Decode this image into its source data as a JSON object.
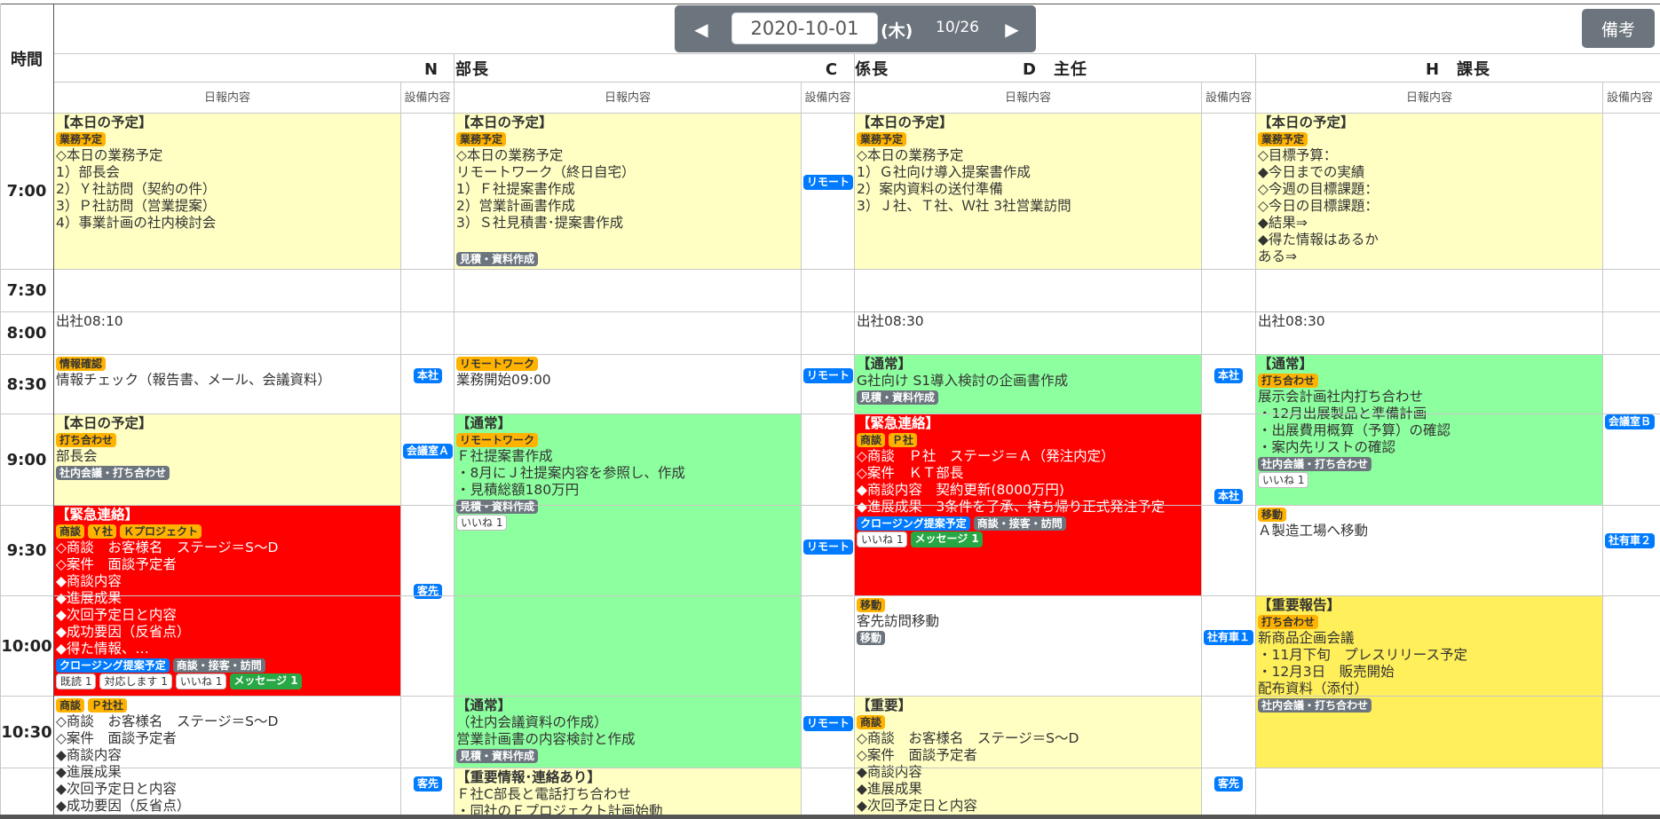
{
  "nav": {
    "prev_icon": "◀",
    "date_value": "2020-10-01",
    "weekday": "(木)",
    "counter": "10/26",
    "next_icon": "▶",
    "notes_button": "備考"
  },
  "table": {
    "time_header": "時間",
    "sub_report": "日報内容",
    "sub_equip_line1": "設備",
    "sub_equip_line2": "内容",
    "people": [
      "N　部長",
      "C　係長",
      "D　主任",
      "H　課長"
    ],
    "time_slots": [
      "7:00",
      "7:30",
      "8:00",
      "8:30",
      "9:00",
      "9:30",
      "10:00",
      "10:30"
    ]
  },
  "entries": [
    {
      "id": "n-700",
      "col": 0,
      "color": "yellow",
      "title": "【本日の予定】",
      "tags_before": [
        {
          "text": "業務予定",
          "style": "orange"
        }
      ],
      "lines": [
        "◇本日の業務予定",
        "1）部長会",
        "2）Ｙ社訪問（契約の件）",
        "3）Ｐ社訪問（営業提案）",
        "4）事業計画の社内検討会"
      ],
      "tags_after": []
    },
    {
      "id": "n-800",
      "col": 0,
      "color": "white",
      "title": "",
      "tags_before": [],
      "lines": [
        "出社08:10"
      ],
      "tags_after": []
    },
    {
      "id": "n-830",
      "col": 0,
      "color": "white",
      "title": "",
      "tags_before": [
        {
          "text": "情報確認",
          "style": "orange"
        }
      ],
      "lines": [
        "情報チェック（報告書、メール、会議資料）"
      ],
      "tags_after": []
    },
    {
      "id": "n-900",
      "col": 0,
      "color": "yellow",
      "title": "【本日の予定】",
      "tags_before": [
        {
          "text": "打ち合わせ",
          "style": "orange"
        }
      ],
      "lines": [
        "部長会"
      ],
      "tags_after": [
        {
          "text": "社内会議・打ち合わせ",
          "style": "gray"
        }
      ]
    },
    {
      "id": "n-930",
      "col": 0,
      "color": "red",
      "title": "【緊急連絡】",
      "tags_before": [
        {
          "text": "商談",
          "style": "orange"
        },
        {
          "text": "Ｙ社",
          "style": "orange"
        },
        {
          "text": "Ｋプロジェクト",
          "style": "orange"
        }
      ],
      "lines": [
        "◇商談　お客様名　ステージ＝S～D",
        "◇案件　面談予定者",
        "◆商談内容",
        "◆進展成果",
        "◆次回予定日と内容",
        "◆成功要因（反省点）",
        "◆得た情報、…"
      ],
      "tags_after": [
        {
          "text": "クロージング提案予定",
          "style": "blue"
        },
        {
          "text": "商談・接客・訪問",
          "style": "gray"
        }
      ],
      "tags_after2": [
        {
          "text": "既読 1",
          "style": "white"
        },
        {
          "text": "対応します 1",
          "style": "white"
        },
        {
          "text": "いいね 1",
          "style": "white"
        },
        {
          "text": "メッセージ 1",
          "style": "green"
        }
      ]
    },
    {
      "id": "n-1030",
      "col": 0,
      "color": "white",
      "title": "",
      "tags_before": [
        {
          "text": "商談",
          "style": "orange"
        },
        {
          "text": "Ｐ社社",
          "style": "orange"
        }
      ],
      "lines": [
        "◇商談　お客様名　ステージ＝S～D",
        "◇案件　面談予定者",
        "◆商談内容",
        "◆進展成果",
        "◆次回予定日と内容",
        "◆成功要因（反省点）"
      ],
      "tags_after": []
    },
    {
      "id": "c-700",
      "col": 1,
      "color": "yellow",
      "title": "【本日の予定】",
      "tags_before": [
        {
          "text": "業務予定",
          "style": "orange"
        }
      ],
      "lines": [
        "◇本日の業務予定",
        "リモートワーク（終日自宅）",
        "1）Ｆ社提案書作成",
        "2）営業計画書作成",
        "3）Ｓ社見積書･提案書作成"
      ],
      "tags_after": [
        {
          "text": "見積・資料作成",
          "style": "gray"
        }
      ]
    },
    {
      "id": "c-830",
      "col": 1,
      "color": "white",
      "title": "",
      "tags_before": [
        {
          "text": "リモートワーク",
          "style": "orange"
        }
      ],
      "lines": [
        "業務開始09:00"
      ],
      "tags_after": []
    },
    {
      "id": "c-900",
      "col": 1,
      "color": "green",
      "title": "【通常】",
      "tags_before": [
        {
          "text": "リモートワーク",
          "style": "orange"
        }
      ],
      "lines": [
        "Ｆ社提案書作成",
        "・8月にＪ社提案内容を参照し、作成",
        "・見積総額180万円"
      ],
      "tags_after": [
        {
          "text": "見積・資料作成",
          "style": "gray"
        }
      ],
      "tags_after2": [
        {
          "text": "いいね 1",
          "style": "white"
        }
      ]
    },
    {
      "id": "c-1030",
      "col": 1,
      "color": "green",
      "title": "【通常】",
      "tags_before": [],
      "lines": [
        "（社内会議資料の作成）",
        "営業計画書の内容検討と作成"
      ],
      "tags_after": [
        {
          "text": "見積・資料作成",
          "style": "gray"
        }
      ]
    },
    {
      "id": "c-1100",
      "col": 1,
      "color": "yellow",
      "title": "【重要情報･連絡あり】",
      "tags_before": [],
      "lines": [
        "Ｆ社C部長と電話打ち合わせ",
        "・同社のＦプロジェクト計画始動"
      ],
      "tags_after": []
    },
    {
      "id": "d-700",
      "col": 2,
      "color": "yellow",
      "title": "【本日の予定】",
      "tags_before": [
        {
          "text": "業務予定",
          "style": "orange"
        }
      ],
      "lines": [
        "◇本日の業務予定",
        "1）Ｇ社向け導入提案書作成",
        "2）案内資料の送付準備",
        "3）Ｊ社、Ｔ社、Ｗ社 3社営業訪問"
      ],
      "tags_after": []
    },
    {
      "id": "d-800",
      "col": 2,
      "color": "white",
      "title": "",
      "tags_before": [],
      "lines": [
        "出社08:30"
      ],
      "tags_after": []
    },
    {
      "id": "d-830",
      "col": 2,
      "color": "green",
      "title": "【通常】",
      "tags_before": [],
      "lines": [
        "G社向け S1導入検討の企画書作成"
      ],
      "tags_after": [
        {
          "text": "見積・資料作成",
          "style": "gray"
        }
      ]
    },
    {
      "id": "d-900",
      "col": 2,
      "color": "red",
      "title": "【緊急連絡】",
      "tags_before": [
        {
          "text": "商談",
          "style": "orange"
        },
        {
          "text": "Ｐ社",
          "style": "orange"
        }
      ],
      "lines": [
        "◇商談　Ｐ社　ステージ＝Ａ（発注内定）",
        "◇案件　ＫＴ部長",
        "◆商談内容　契約更新(8000万円)",
        "◆進展成果　3条件を了承、持ち帰り正式発注予定"
      ],
      "tags_after": [
        {
          "text": "クロージング提案予定",
          "style": "blue"
        },
        {
          "text": "商談・接客・訪問",
          "style": "gray"
        }
      ],
      "tags_after2": [
        {
          "text": "いいね 1",
          "style": "white"
        },
        {
          "text": "メッセージ 1",
          "style": "green"
        }
      ]
    },
    {
      "id": "d-1000",
      "col": 2,
      "color": "white",
      "title": "",
      "tags_before": [
        {
          "text": "移動",
          "style": "orange"
        }
      ],
      "lines": [
        "客先訪問移動"
      ],
      "tags_after": [
        {
          "text": "移動",
          "style": "gray"
        }
      ]
    },
    {
      "id": "d-1030",
      "col": 2,
      "color": "yellow",
      "title": "【重要】",
      "tags_before": [
        {
          "text": "商談",
          "style": "orange"
        }
      ],
      "lines": [
        "◇商談　お客様名　ステージ＝S～D",
        "◇案件　面談予定者",
        "◆商談内容",
        "◆進展成果",
        "◆次回予定日と内容"
      ],
      "tags_after": []
    },
    {
      "id": "h-700",
      "col": 3,
      "color": "yellow",
      "title": "【本日の予定】",
      "tags_before": [
        {
          "text": "業務予定",
          "style": "orange"
        }
      ],
      "lines": [
        "◇目標予算：",
        "◆今日までの実績",
        "◇今週の目標課題：",
        "◇今日の目標課題：",
        "◆結果⇒",
        "◆得た情報はあるか",
        "ある⇒"
      ],
      "tags_after": []
    },
    {
      "id": "h-800",
      "col": 3,
      "color": "white",
      "title": "",
      "tags_before": [],
      "lines": [
        "出社08:30"
      ],
      "tags_after": []
    },
    {
      "id": "h-830",
      "col": 3,
      "color": "green",
      "title": "【通常】",
      "tags_before": [
        {
          "text": "打ち合わせ",
          "style": "orange"
        }
      ],
      "lines": [
        "展示会計画社内打ち合わせ",
        "・12月出展製品と準備計画",
        "・出展費用概算（予算）の確認",
        "・案内先リストの確認"
      ],
      "tags_after": [
        {
          "text": "社内会議・打ち合わせ",
          "style": "gray"
        }
      ],
      "tags_after2": [
        {
          "text": "いいね 1",
          "style": "white"
        }
      ]
    },
    {
      "id": "h-930",
      "col": 3,
      "color": "white",
      "title": "",
      "tags_before": [
        {
          "text": "移動",
          "style": "orange"
        }
      ],
      "lines": [
        "Ａ製造工場へ移動"
      ],
      "tags_after": []
    },
    {
      "id": "h-1000",
      "col": 3,
      "color": "gold",
      "title": "【重要報告】",
      "tags_before": [
        {
          "text": "打ち合わせ",
          "style": "orange"
        }
      ],
      "lines": [
        "新商品企画会議",
        "・11月下旬　プレスリリース予定",
        "・12月3日　販売開始",
        "配布資料（添付）"
      ],
      "tags_after": [
        {
          "text": "社内会議・打ち合わせ",
          "style": "gray"
        }
      ]
    }
  ],
  "equipment": [
    {
      "id": "c-700-eq",
      "col": 1,
      "label": "リモート"
    },
    {
      "id": "n-830-eq",
      "col": 0,
      "label": "本社"
    },
    {
      "id": "c-830-eq",
      "col": 1,
      "label": "リモート"
    },
    {
      "id": "d-830-eq",
      "col": 2,
      "label": "本社"
    },
    {
      "id": "n-900-eq",
      "col": 0,
      "label": "会議室Ａ"
    },
    {
      "id": "h-900-eq",
      "col": 3,
      "label": "会議室Ｂ"
    },
    {
      "id": "d-915-eq",
      "col": 2,
      "label": "本社"
    },
    {
      "id": "c-930-eq",
      "col": 1,
      "label": "リモート"
    },
    {
      "id": "n-930-eq",
      "col": 0,
      "label": "客先"
    },
    {
      "id": "h-930-eq",
      "col": 3,
      "label": "社有車２"
    },
    {
      "id": "d-1000-eq",
      "col": 2,
      "label": "社有車１"
    },
    {
      "id": "c-1030-eq",
      "col": 1,
      "label": "リモート"
    },
    {
      "id": "n-1030-eq",
      "col": 0,
      "label": "客先"
    },
    {
      "id": "d-1030-eq",
      "col": 2,
      "label": "客先"
    }
  ]
}
